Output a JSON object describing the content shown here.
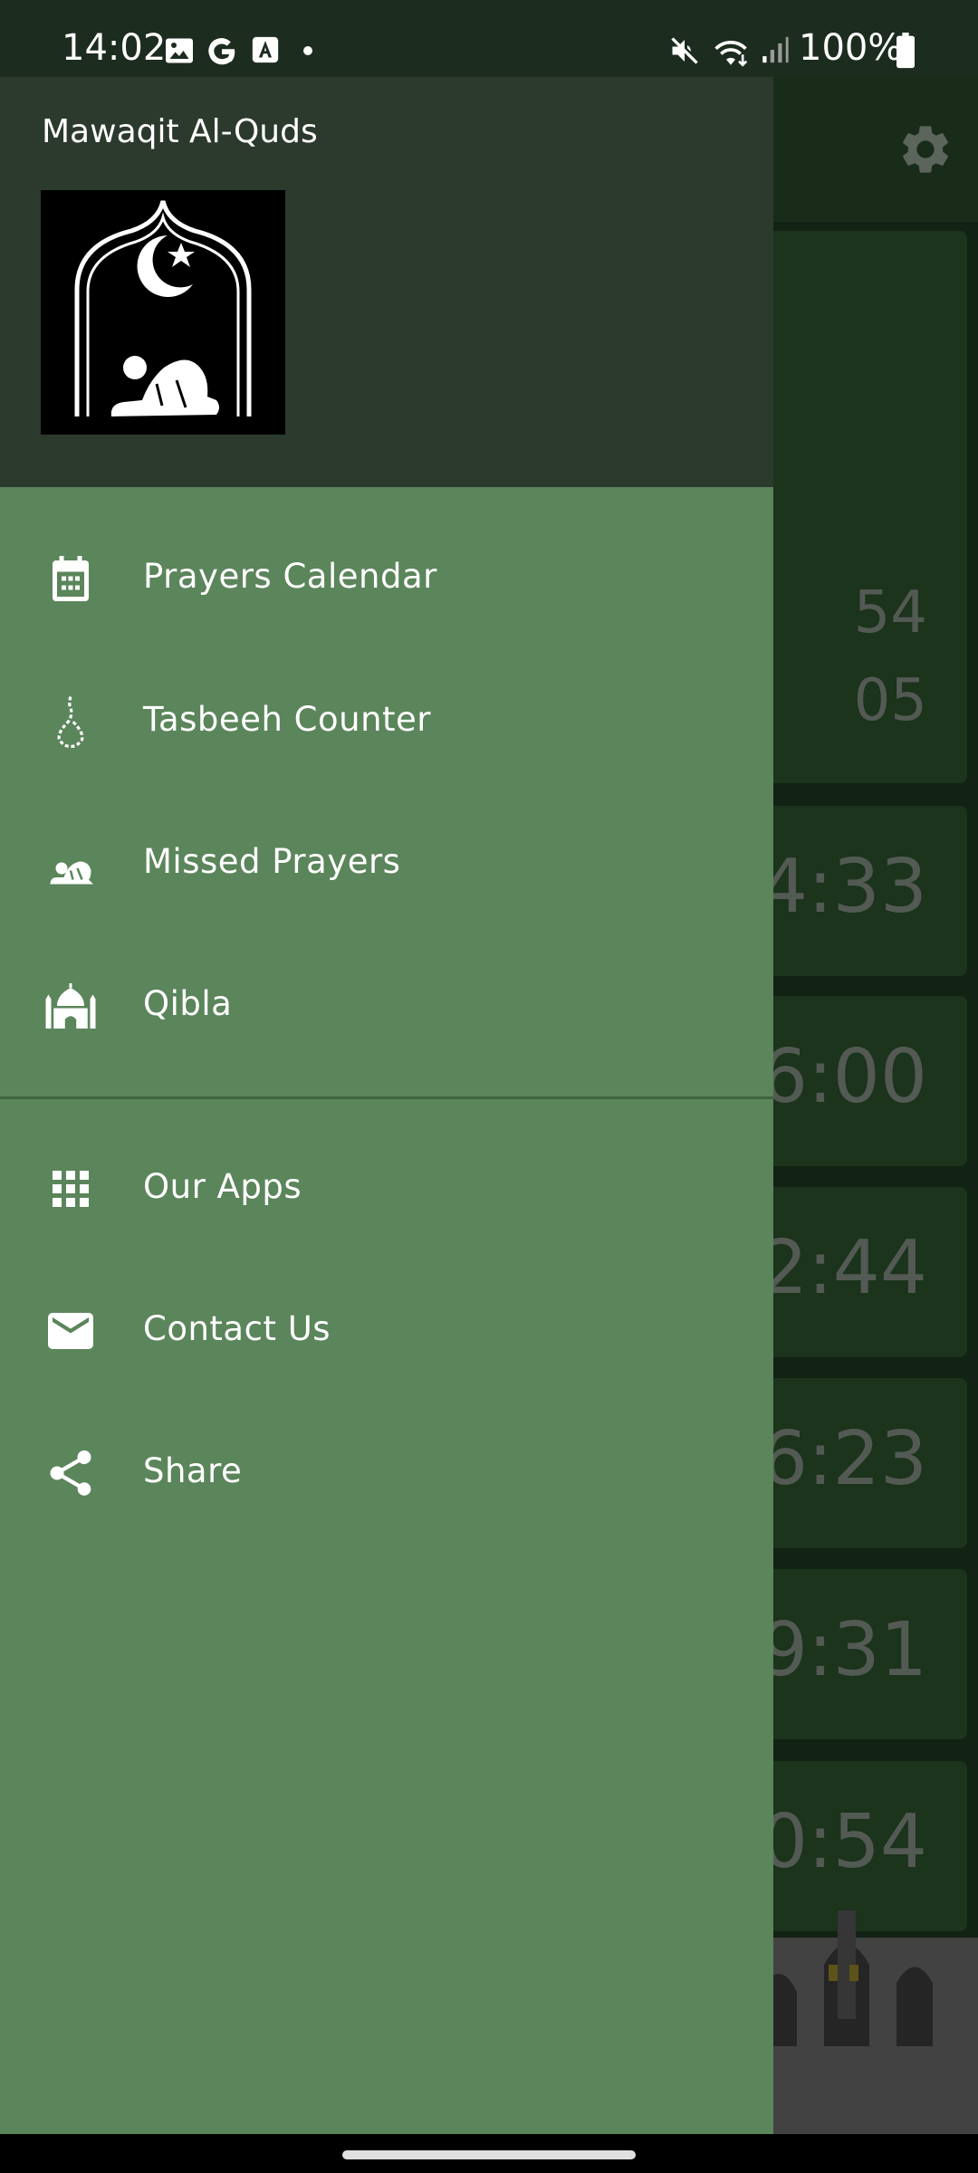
{
  "status_bar": {
    "time": "14:02",
    "battery_percent": "100%",
    "icons": [
      "gallery-icon",
      "google-g-icon",
      "translate-a-icon",
      "dot-icon",
      "mute-icon",
      "wifi-icon",
      "signal-icon",
      "battery-icon"
    ]
  },
  "drawer": {
    "app_name": "Mawaqit Al-Quds",
    "logo": "mosque-prostration-logo",
    "primary_items": [
      {
        "label": "Prayers Calendar",
        "icon": "calendar-icon"
      },
      {
        "label": "Tasbeeh Counter",
        "icon": "prayer-beads-icon"
      },
      {
        "label": "Missed Prayers",
        "icon": "prostration-icon"
      },
      {
        "label": "Qibla",
        "icon": "mosque-icon"
      }
    ],
    "secondary_items": [
      {
        "label": "Our Apps",
        "icon": "apps-grid-icon"
      },
      {
        "label": "Contact Us",
        "icon": "mail-icon"
      },
      {
        "label": "Share",
        "icon": "share-icon"
      }
    ]
  },
  "background_app": {
    "settings_icon": "gear-icon",
    "times": [
      "54",
      "05",
      "4:33",
      "6:00",
      "2:44",
      "6:23",
      "9:31",
      "0:54"
    ]
  },
  "colors": {
    "drawer_bg": "#5b855b",
    "drawer_header_bg": "#2b3a2c",
    "status_bar_bg": "#1c2c1e"
  }
}
